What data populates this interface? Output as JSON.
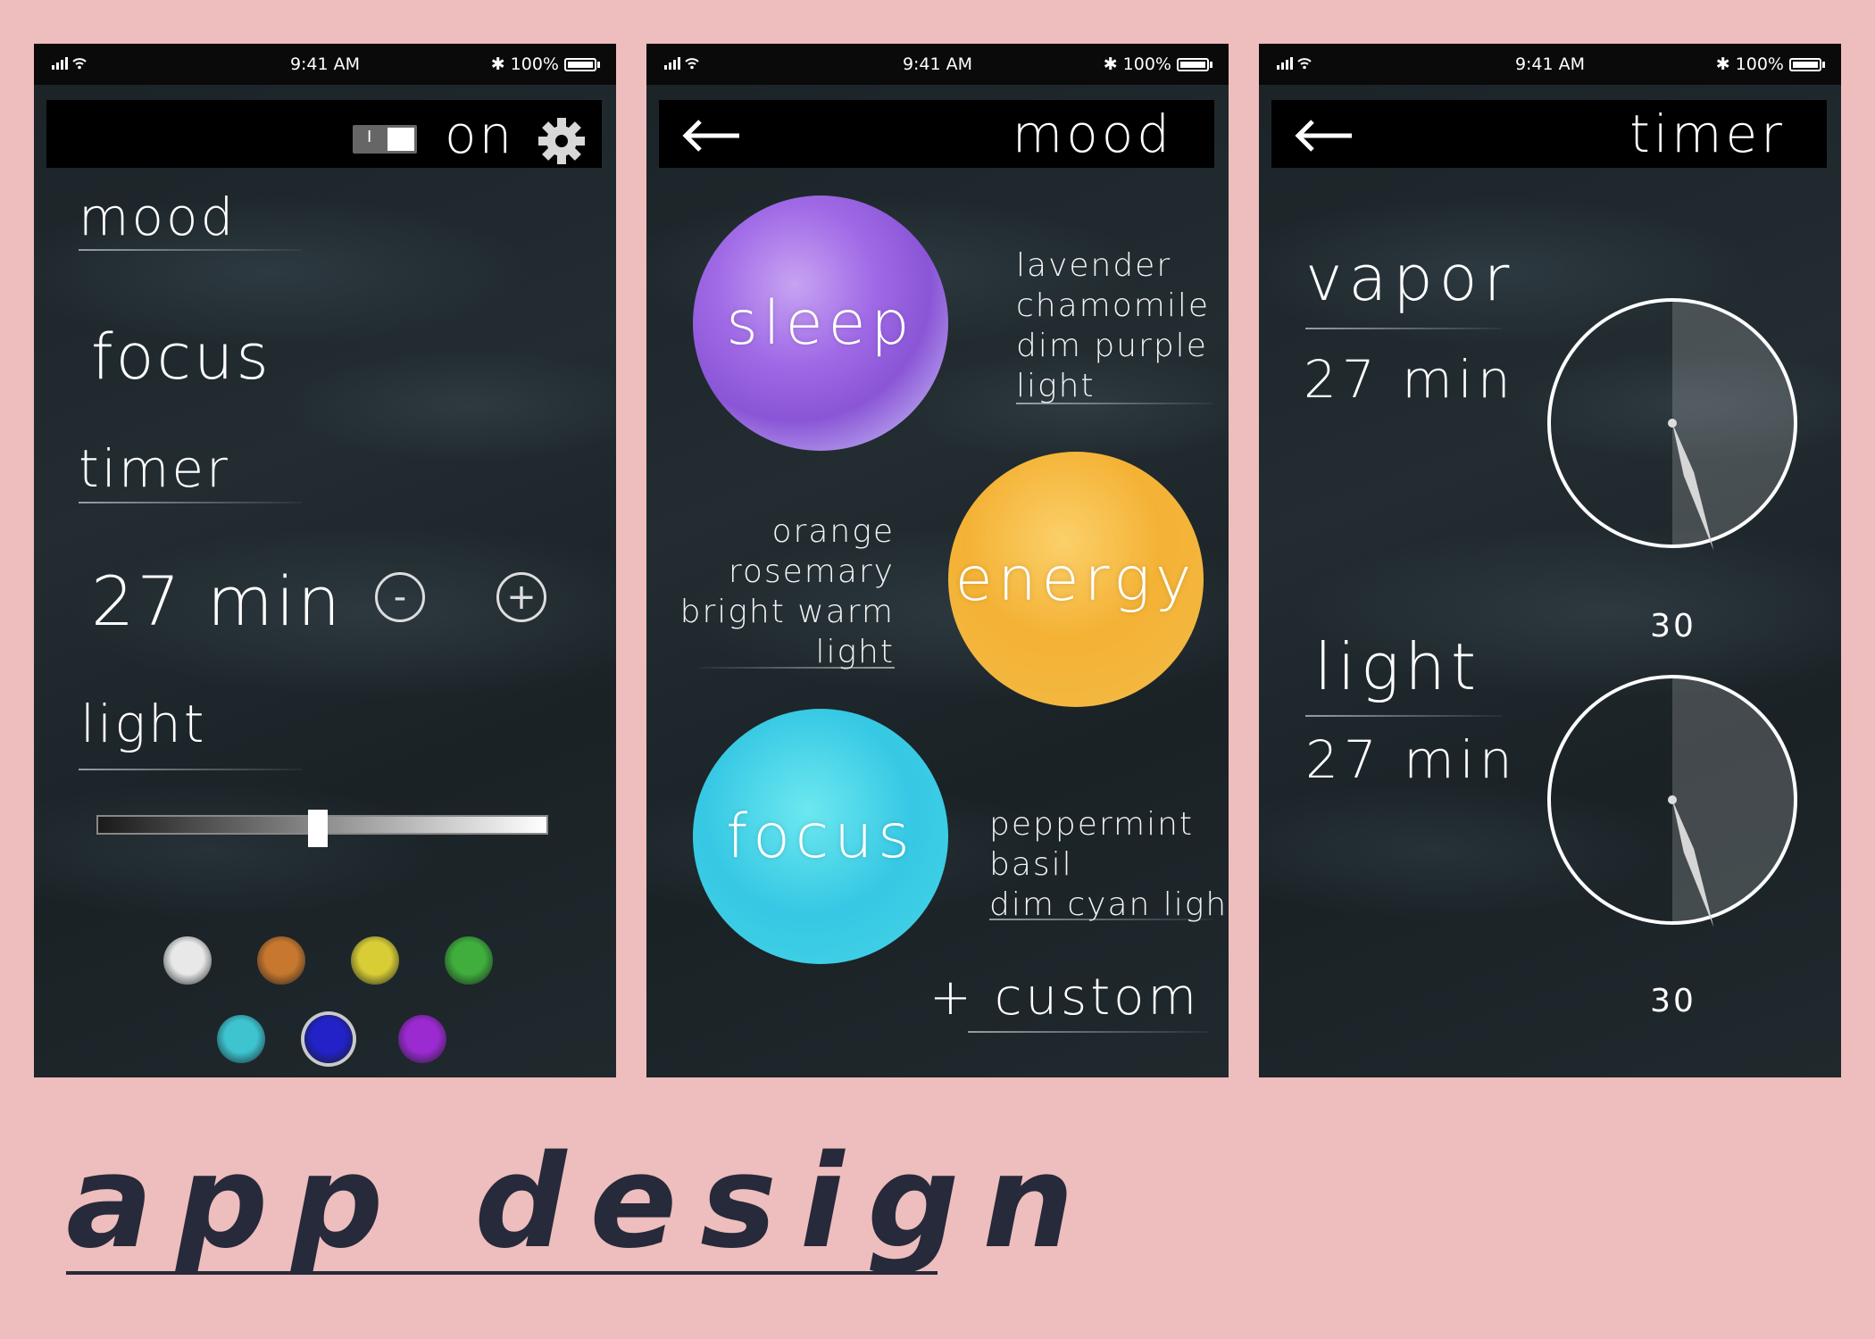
{
  "status_bar": {
    "time": "9:41 AM",
    "battery": "100%"
  },
  "home": {
    "power_label": "on",
    "mood_heading": "mood",
    "mood_value": "focus",
    "timer_heading": "timer",
    "timer_value": "27 min",
    "minus_label": "-",
    "plus_label": "+",
    "light_heading": "light",
    "brightness_fraction": 0.49,
    "swatches": [
      {
        "name": "white",
        "color": "#e8e8e8"
      },
      {
        "name": "orange",
        "color": "#c8782e"
      },
      {
        "name": "yellow",
        "color": "#d8cd35"
      },
      {
        "name": "green",
        "color": "#3fae3c"
      },
      {
        "name": "cyan",
        "color": "#3dc4cf"
      },
      {
        "name": "blue",
        "color": "#2222c8",
        "selected": true
      },
      {
        "name": "purple",
        "color": "#9b2ad0"
      }
    ]
  },
  "mood": {
    "title": "mood",
    "moods": [
      {
        "name": "sleep",
        "lines": [
          "lavender",
          "chamomile",
          "dim purple",
          "light"
        ]
      },
      {
        "name": "energy",
        "lines": [
          "orange",
          "rosemary",
          "bright warm",
          "light"
        ]
      },
      {
        "name": "focus",
        "lines": [
          "peppermint",
          "basil",
          "dim cyan light"
        ]
      }
    ],
    "custom_label": "+ custom"
  },
  "timer": {
    "title": "timer",
    "sections": [
      {
        "label": "vapor",
        "value": "27 min",
        "dial_number": "30",
        "dial_max_minutes": 60,
        "minutes": 27
      },
      {
        "label": "light",
        "value": "27 min",
        "dial_number": "30",
        "dial_max_minutes": 60,
        "minutes": 27
      }
    ]
  },
  "footer": {
    "title": "app design"
  }
}
